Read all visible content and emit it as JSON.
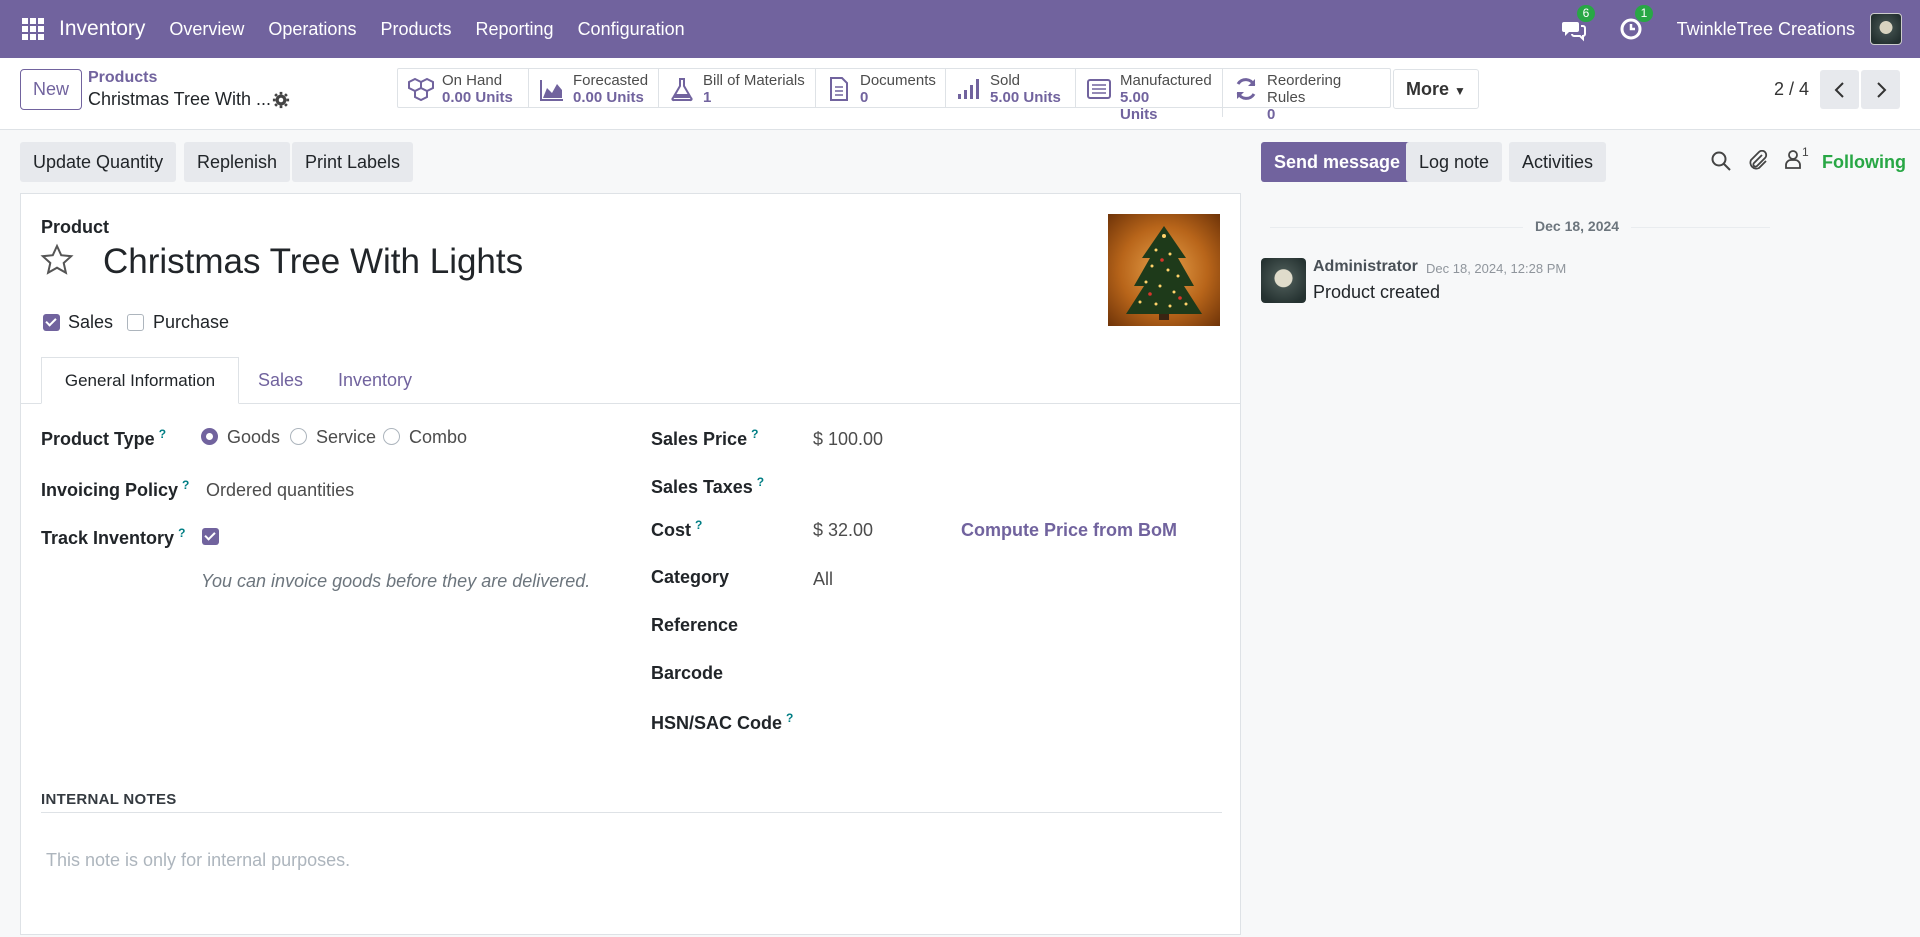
{
  "nav": {
    "app_name": "Inventory",
    "menu": [
      "Overview",
      "Operations",
      "Products",
      "Reporting",
      "Configuration"
    ],
    "messages_count": "6",
    "activities_count": "1",
    "company": "TwinkleTree Creations"
  },
  "control": {
    "new_label": "New",
    "breadcrumb_parent": "Products",
    "breadcrumb_current": "Christmas Tree With ...",
    "smart_buttons": [
      {
        "label": "On Hand",
        "value": "0.00 Units",
        "icon": "cubes-icon"
      },
      {
        "label": "Forecasted",
        "value": "0.00 Units",
        "icon": "area-chart-icon"
      },
      {
        "label": "Bill of Materials",
        "value": "1",
        "icon": "flask-icon"
      },
      {
        "label": "Documents",
        "value": "0",
        "icon": "file-icon"
      },
      {
        "label": "Sold",
        "value": "5.00 Units",
        "icon": "signal-icon"
      },
      {
        "label": "Manufactured",
        "value": "5.00",
        "value2": "Units",
        "icon": "list-icon"
      },
      {
        "label": "Reordering Rules",
        "value": "0",
        "icon": "refresh-icon"
      }
    ],
    "more_label": "More",
    "pager": "2 / 4"
  },
  "actions": {
    "update_quantity": "Update Quantity",
    "replenish": "Replenish",
    "print_labels": "Print Labels",
    "send_message": "Send message",
    "log_note": "Log note",
    "activities": "Activities",
    "followers_count": "1",
    "following": "Following"
  },
  "form": {
    "product_label": "Product",
    "product_name": "Christmas Tree With Lights",
    "sales_label": "Sales",
    "purchase_label": "Purchase",
    "tabs": [
      "General Information",
      "Sales",
      "Inventory"
    ],
    "product_type_label": "Product Type",
    "product_type_options": [
      "Goods",
      "Service",
      "Combo"
    ],
    "invoicing_policy_label": "Invoicing Policy",
    "invoicing_policy_value": "Ordered quantities",
    "track_inventory_label": "Track Inventory",
    "invoice_hint": "You can invoice goods before they are delivered.",
    "sales_price_label": "Sales Price",
    "sales_price_value": "$ 100.00",
    "sales_taxes_label": "Sales Taxes",
    "cost_label": "Cost",
    "cost_value": "$ 32.00",
    "compute_price_label": "Compute Price from BoM",
    "category_label": "Category",
    "category_value": "All",
    "reference_label": "Reference",
    "barcode_label": "Barcode",
    "hsn_label": "HSN/SAC Code",
    "help_mark": "?",
    "internal_notes_label": "INTERNAL NOTES",
    "internal_notes_placeholder": "This note is only for internal purposes."
  },
  "chatter": {
    "date_separator": "Dec 18, 2024",
    "author": "Administrator",
    "timestamp": "Dec 18, 2024, 12:28 PM",
    "message": "Product created"
  },
  "colors": {
    "brand": "#71639e",
    "following": "#28a745",
    "help": "#017e84"
  }
}
